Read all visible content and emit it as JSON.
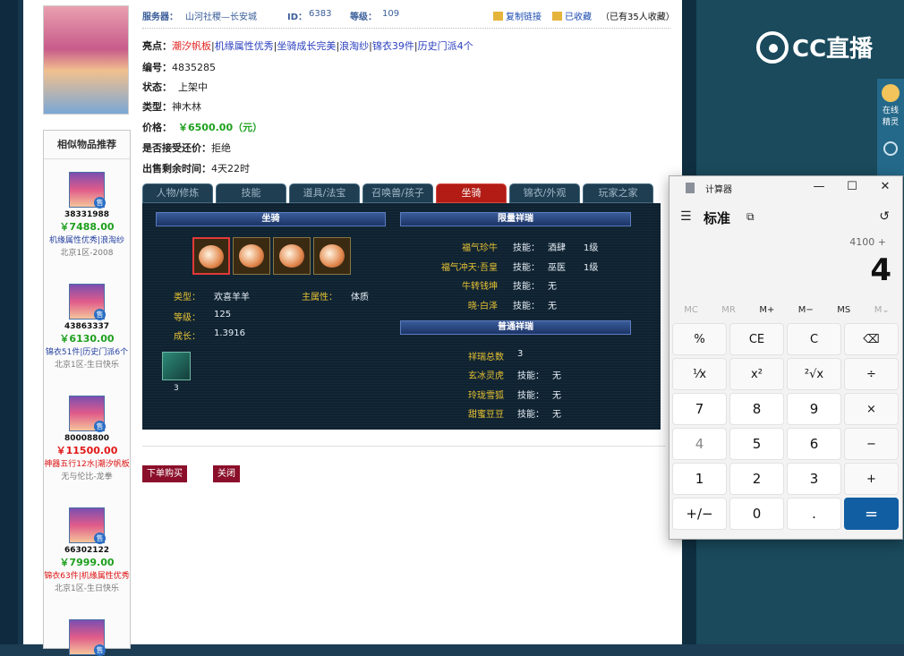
{
  "header": {
    "server_label": "服务器：",
    "server_value": "山河社稷—长安城",
    "id_label": "ID：",
    "id_value": "6383",
    "level_label": "等级：",
    "level_value": "109",
    "copy_link": "复制链接",
    "favorited": "已收藏",
    "fav_count_text": "（已有35人收藏）"
  },
  "info": {
    "highlights_label": "亮点：",
    "highlights": [
      "潮汐帆板",
      "机缘属性优秀",
      "坐骑成长完美",
      "浪淘纱",
      "锦衣39件",
      "历史门派4个"
    ],
    "number_label": "编号：",
    "number_value": "4835285",
    "status_label": "状态：",
    "status_value": "上架中",
    "type_label": "类型：",
    "type_value": "神木林",
    "price_label": "价格：",
    "price_value": "￥6500.00（元）",
    "bargain_label": "是否接受还价：",
    "bargain_value": "拒绝",
    "remaining_label": "出售剩余时间：",
    "remaining_value": "4天22时"
  },
  "tabs": [
    "人物/修炼",
    "技能",
    "道具/法宝",
    "召唤兽/孩子",
    "坐骑",
    "锦衣/外观",
    "玩家之家"
  ],
  "mount": {
    "section_title": "坐骑",
    "type_label": "类型：",
    "type_value": "欢喜羊羊",
    "main_attr_label": "主属性：",
    "main_attr_value": "体质",
    "level_label": "等级：",
    "level_value": "125",
    "growth_label": "成长：",
    "growth_value": "1.3916",
    "skill_count": "3"
  },
  "limited": {
    "title": "限量祥瑞",
    "rows": [
      {
        "name": "福气珍牛",
        "skill_label": "技能：",
        "skill": "酒肆",
        "lvl": "1级"
      },
      {
        "name": "福气冲天·吾皇",
        "skill_label": "技能：",
        "skill": "巫医",
        "lvl": "1级"
      },
      {
        "name": "牛转钱坤",
        "skill_label": "技能：",
        "skill": "无",
        "lvl": ""
      },
      {
        "name": "晓·白泽",
        "skill_label": "技能：",
        "skill": "无",
        "lvl": ""
      }
    ]
  },
  "common": {
    "title": "普通祥瑞",
    "total_label": "祥瑞总数",
    "total_value": "3",
    "rows": [
      {
        "name": "玄冰灵虎",
        "skill_label": "技能：",
        "skill": "无"
      },
      {
        "name": "玲珑雪狐",
        "skill_label": "技能：",
        "skill": "无"
      },
      {
        "name": "甜蜜豆豆",
        "skill_label": "技能：",
        "skill": "无"
      }
    ]
  },
  "buttons": {
    "buy": "下单购买",
    "close": "关闭"
  },
  "similar": {
    "title": "相似物品推荐",
    "items": [
      {
        "id": "38331988",
        "price": "￥7488.00",
        "tag": "机缘属性优秀|浪淘纱",
        "server": "北京1区-2008"
      },
      {
        "id": "43863337",
        "price": "￥6130.00",
        "tag": "锦衣51件|历史门派6个",
        "server": "北京1区-生日快乐"
      },
      {
        "id": "80008800",
        "price": "￥11500.00",
        "tag": "神器五行12水|潮汐帆板",
        "server": "无与伦比-龙拳"
      },
      {
        "id": "66302122",
        "price": "￥7999.00",
        "tag": "锦衣63件|机缘属性优秀",
        "server": "北京1区-生日快乐"
      }
    ]
  },
  "overlay": {
    "brand": "CC直播",
    "widget_label": "在线精灵"
  },
  "calculator": {
    "title": "计算器",
    "mode": "标准",
    "expression": "4100 +",
    "display": "4",
    "memory": [
      "MC",
      "MR",
      "M+",
      "M−",
      "MS",
      "M⌄"
    ],
    "keys": [
      "%",
      "CE",
      "C",
      "⌫",
      "⅟x",
      "x²",
      "²√x",
      "÷",
      "7",
      "8",
      "9",
      "×",
      "4",
      "5",
      "6",
      "−",
      "1",
      "2",
      "3",
      "+",
      "+/−",
      "0",
      ".",
      "="
    ]
  }
}
